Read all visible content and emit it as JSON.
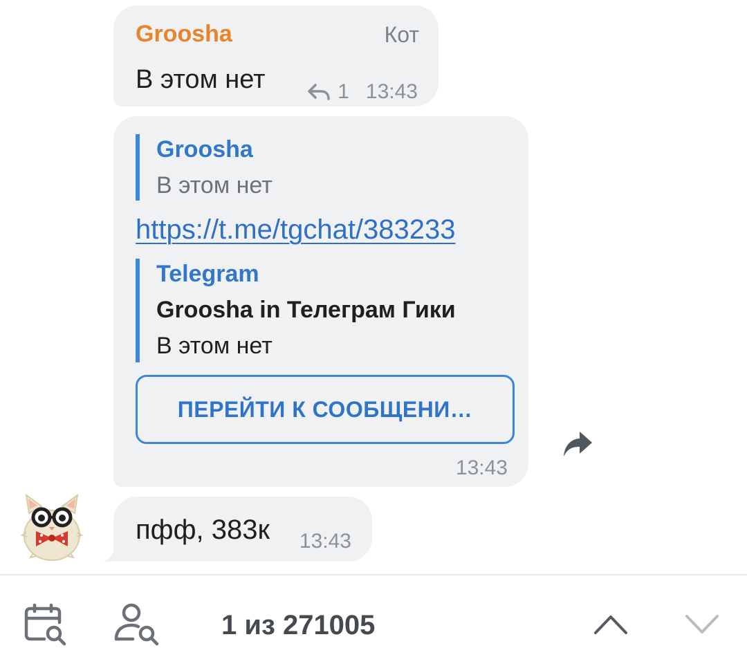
{
  "messages": [
    {
      "sender": "Groosha",
      "admin_title": "Кот",
      "text": "В этом нет",
      "reply_count": "1",
      "time": "13:43",
      "sender_color": "#e8842a"
    },
    {
      "reply_quote": {
        "name": "Groosha",
        "text": "В этом нет"
      },
      "link": "https://t.me/tgchat/383233",
      "preview": {
        "site": "Telegram",
        "title": "Groosha in Телеграм Гики",
        "description": "В этом нет"
      },
      "button_label": "ПЕРЕЙТИ К СООБЩЕНИ…",
      "time": "13:43"
    },
    {
      "text": "пфф, 383к",
      "time": "13:43",
      "avatar": "cat-with-glasses-avatar"
    }
  ],
  "search_bar": {
    "counter": "1 из 271005",
    "icons": [
      "calendar-search-icon",
      "user-search-icon",
      "chevron-up-icon",
      "chevron-down-icon"
    ]
  },
  "colors": {
    "bubble": "#f0f1f3",
    "link": "#2f6fc4",
    "accent": "#3d87d6",
    "meta": "#8c9197"
  }
}
